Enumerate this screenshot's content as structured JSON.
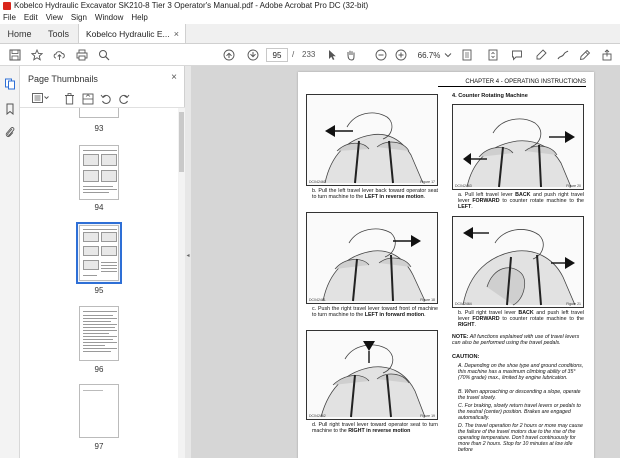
{
  "window": {
    "title": "Kobelco Hydraulic Excavator SK210-8 Tier 3 Operator's Manual.pdf - Adobe Acrobat Pro DC (32-bit)"
  },
  "menu": [
    "File",
    "Edit",
    "View",
    "Sign",
    "Window",
    "Help"
  ],
  "tabs": {
    "home": "Home",
    "tools": "Tools",
    "document": "Kobelco Hydraulic E...",
    "close": "×"
  },
  "toolbar": {
    "current_page": "95",
    "page_sep": "/",
    "total_pages": "233",
    "zoom": "66.7%"
  },
  "panel": {
    "title": "Page Thumbnails",
    "close": "×",
    "thumbnails": [
      {
        "label": "93"
      },
      {
        "label": "94"
      },
      {
        "label": "95",
        "selected": true
      },
      {
        "label": "96"
      },
      {
        "label": "97"
      }
    ]
  },
  "document": {
    "chapter": "CHAPTER 4 - OPERATING INSTRUCTIONS",
    "figs": {
      "f17": {
        "code": "DC042460",
        "num": "Figure 17"
      },
      "f18": {
        "code": "DC042461",
        "num": "Figure 18"
      },
      "f19": {
        "code": "DC042462",
        "num": "Figure 19"
      },
      "f20": {
        "code": "DC042463",
        "num": "Figure 20"
      },
      "f21": {
        "code": "DC042464",
        "num": "Figure 21"
      }
    },
    "cap_b": {
      "pre": "b.  Pull the left travel lever back toward operator seat to turn machine to the ",
      "bold": "LEFT in reverse motion",
      "post": "."
    },
    "cap_c": {
      "pre": "c.  Push the right travel lever toward front of machine to turn machine to the ",
      "bold": "LEFT in forward motion",
      "post": "."
    },
    "cap_d": {
      "pre": "d.  Pull right travel lever toward operator seat to turn machine to the ",
      "bold": "RIGHT in reverse motion",
      "post": ""
    },
    "section4": "4.   Counter Rotating Machine",
    "cap_a2": {
      "t1": "a.  Pull left travel lever ",
      "b1": "BACK",
      "t2": " and push right travel lever ",
      "b2": "FORWARD",
      "t3": " to counter rotate machine to the ",
      "b3": "LEFT",
      "t4": "."
    },
    "cap_b2": {
      "t1": "b.  Pull right travel lever ",
      "b1": "BACK",
      "t2": " and push left travel lever ",
      "b2": "FORWARD",
      "t3": " to counter rotate machine to the ",
      "b3": "RIGHT",
      "t4": "."
    },
    "note_label": "NOTE:",
    "note_text": " All functions explained with use of travel levers can also be performed using the travel pedals.",
    "caution_label": "CAUTION:",
    "caution_items": [
      "A. Depending on the shoe type and ground conditions, this machine has a maximum climbing ability of 35° (70% grade) max., limited by engine lubrication.",
      "B. When approaching or descending a slope, operate the travel slowly.",
      "C. For braking, slowly return travel levers or pedals to the neutral (center) position. Brakes are engaged automatically.",
      "D. The travel operation for 2 hours or more may cause the failure of the travel motors due to the rise of the operating temperature. Don't travel continuously for more than 2 hours. Stop for 10 minutes at low idle before"
    ]
  }
}
